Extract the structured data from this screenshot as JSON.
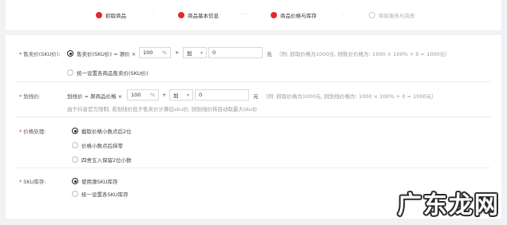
{
  "steps": [
    {
      "label": "抓取商品",
      "state": "active"
    },
    {
      "label": "商品基本信息",
      "state": "active"
    },
    {
      "label": "商品价格与库存",
      "state": "active"
    },
    {
      "label": "商家服务与资质",
      "state": "inactive"
    }
  ],
  "step_separator": "···",
  "sale_price": {
    "label": "售卖价(SKU价):",
    "option1": "售卖价(SKU价) = 源价 ×",
    "percent_value": "100",
    "percent_unit": "%",
    "plus": "+",
    "operator": "加",
    "addend": "0",
    "unit": "元",
    "hint": "（例: 抓取价格为1000元, 则售价价格为: 1000 × 100% + 0 = 1000元）",
    "option2": "统一设置各商品售卖价(SKU价)"
  },
  "strike_price": {
    "label": "划线价:",
    "formula": "划线价 = 原商品价格 ×",
    "percent_value": "100",
    "percent_unit": "%",
    "plus": "+",
    "operator": "加",
    "addend": "0",
    "unit": "元",
    "hint": "（例: 抓取价格为1000元, 则划线价格为: 1000 × 100% + 0 = 1000元）",
    "note": "由于抖音官方限制, 若划线价低于售卖价计算后sku价, 则划线价将自动取最大sku价"
  },
  "price_handling": {
    "label": "价格处理:",
    "options": [
      "截取价格小数点后2位",
      "价格小数点后抹零",
      "四舍五入保留2位小数"
    ],
    "selected": 0
  },
  "sku_stock": {
    "label": "SKU库存:",
    "options": [
      "使用源SKU库存",
      "统一设置各SKU库存"
    ],
    "selected": 0
  },
  "required_mark": "*",
  "watermark": "广东龙网"
}
